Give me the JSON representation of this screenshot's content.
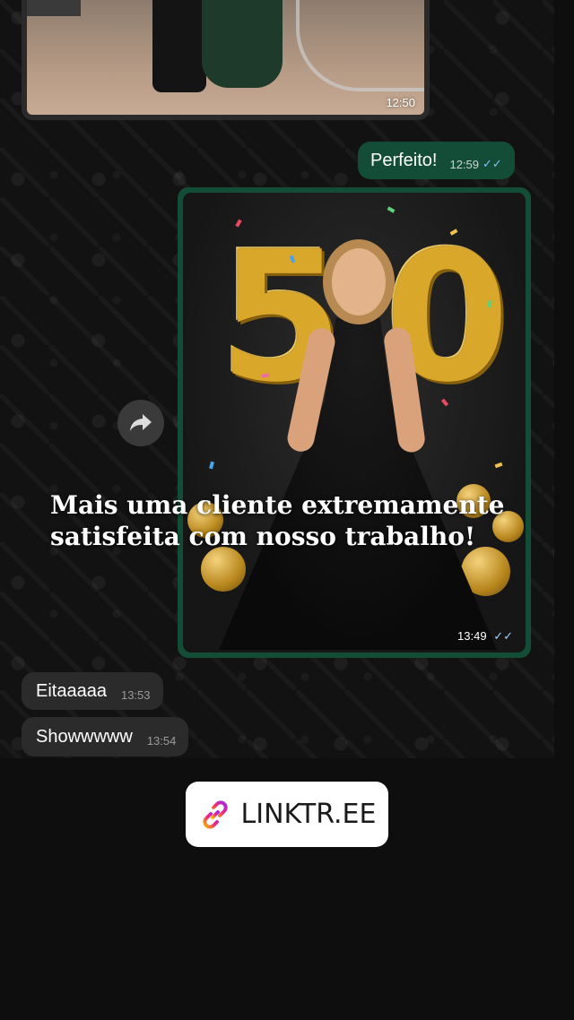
{
  "chat": {
    "photo_top": {
      "time": "12:50"
    },
    "messages": [
      {
        "id": "perfeito",
        "text": "Perfeito!",
        "time": "12:59",
        "direction": "out",
        "status": "read"
      },
      {
        "id": "eitaaaaa",
        "text": "Eitaaaaa",
        "time": "13:53",
        "direction": "in"
      },
      {
        "id": "showwww",
        "text": "Showwwww",
        "time": "13:54",
        "direction": "in"
      }
    ],
    "photo_main": {
      "time": "13:49",
      "status": "read",
      "balloon_text": "50"
    },
    "forward_icon": "forward-arrow-icon"
  },
  "caption": {
    "line1": "Mais uma cliente extremamente",
    "line2": "satisfeita com nosso trabalho!"
  },
  "link_sticker": {
    "label": "LINKTR.EE",
    "icon": "link-icon"
  },
  "colors": {
    "outgoing_bubble": "#144d37",
    "incoming_bubble": "#2b2b2b",
    "read_check": "#7fc0ff",
    "background": "#0e0e0e"
  }
}
